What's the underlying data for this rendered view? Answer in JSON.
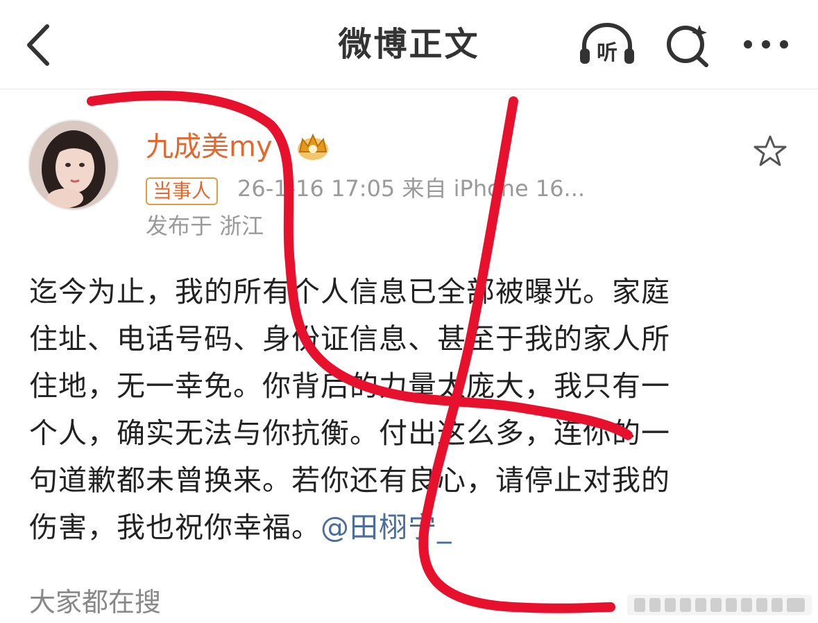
{
  "header": {
    "title": "微博正文",
    "back_icon": "chevron-left-icon",
    "listen_label": "听",
    "search_icon": "ai-search-icon",
    "more_icon": "more-dots-icon"
  },
  "post": {
    "username": "九成美my",
    "crown_icon": "crown-icon",
    "badge": "当事人",
    "time_source": "26-1-16 17:05  来自 iPhone 16...",
    "location": "发布于 浙江",
    "favorite_icon": "star-outline-icon",
    "content_lines": [
      "迄今为止，我的所有个人信息已全部被曝光。家庭",
      "住址、电话号码、身份证信息、甚至于我的家人所",
      "住地，无一幸免。你背后的力量太庞大，我只有一",
      "个人，确实无法与你抗衡。付出这么多，连你的一",
      "句道歉都未曾换来。若你还有良心，请停止对我的",
      "伤害，我也祝你幸福。"
    ],
    "mention": "@田栩宁_"
  },
  "footer": {
    "search_hint": "大家都在搜"
  },
  "colors": {
    "username": "#e5672d",
    "mention": "#4a6d9c",
    "scribble": "#e8112d",
    "meta": "#9a9a9a"
  }
}
